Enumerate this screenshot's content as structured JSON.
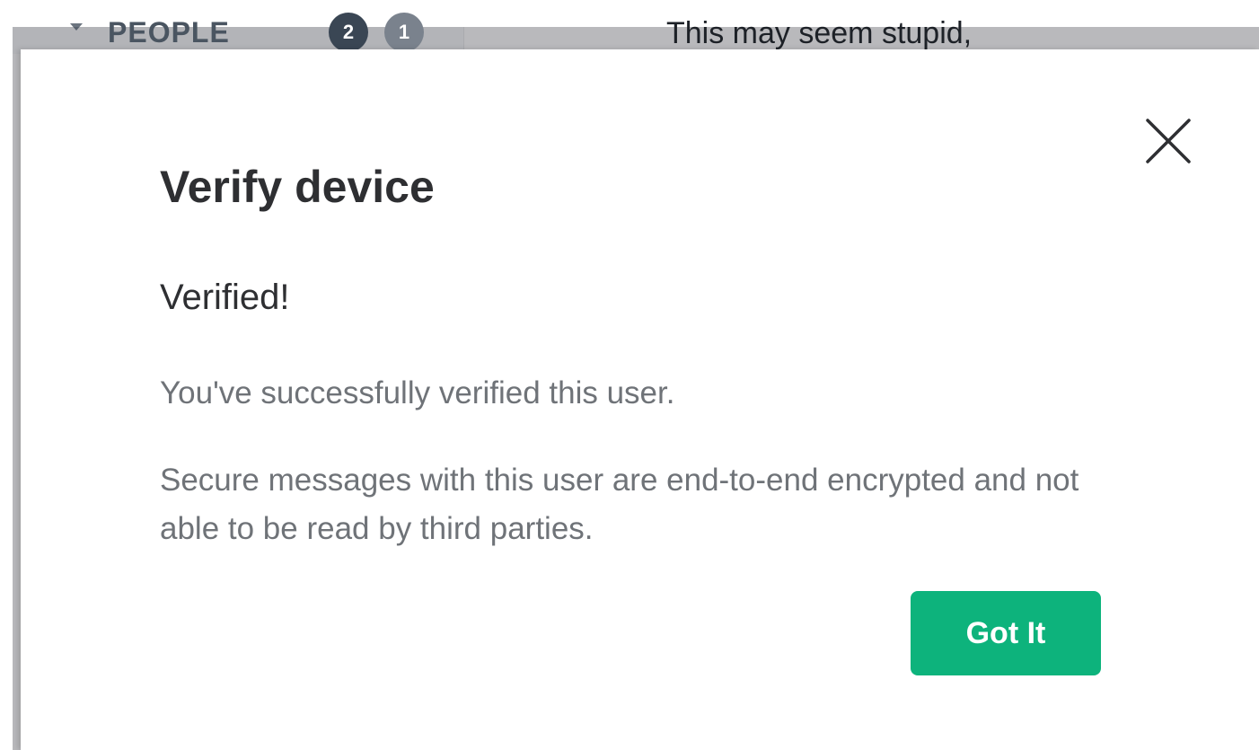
{
  "background": {
    "sidebar": {
      "section_label": "PEOPLE",
      "badge_count_primary": "2",
      "badge_count_secondary": "1"
    },
    "timeline": {
      "message_text": "This may seem stupid,"
    }
  },
  "dialog": {
    "title": "Verify device",
    "heading": "Verified!",
    "message_1": "You've successfully verified this user.",
    "message_2": "Secure messages with this user are end-to-end encrypted and not able to be read by third parties.",
    "confirm_label": "Got It",
    "close_icon": "close-icon"
  },
  "colors": {
    "accent": "#0db37c",
    "title_text": "#2e2f32",
    "body_text": "#6f7378",
    "overlay": "#b9b9bc"
  }
}
